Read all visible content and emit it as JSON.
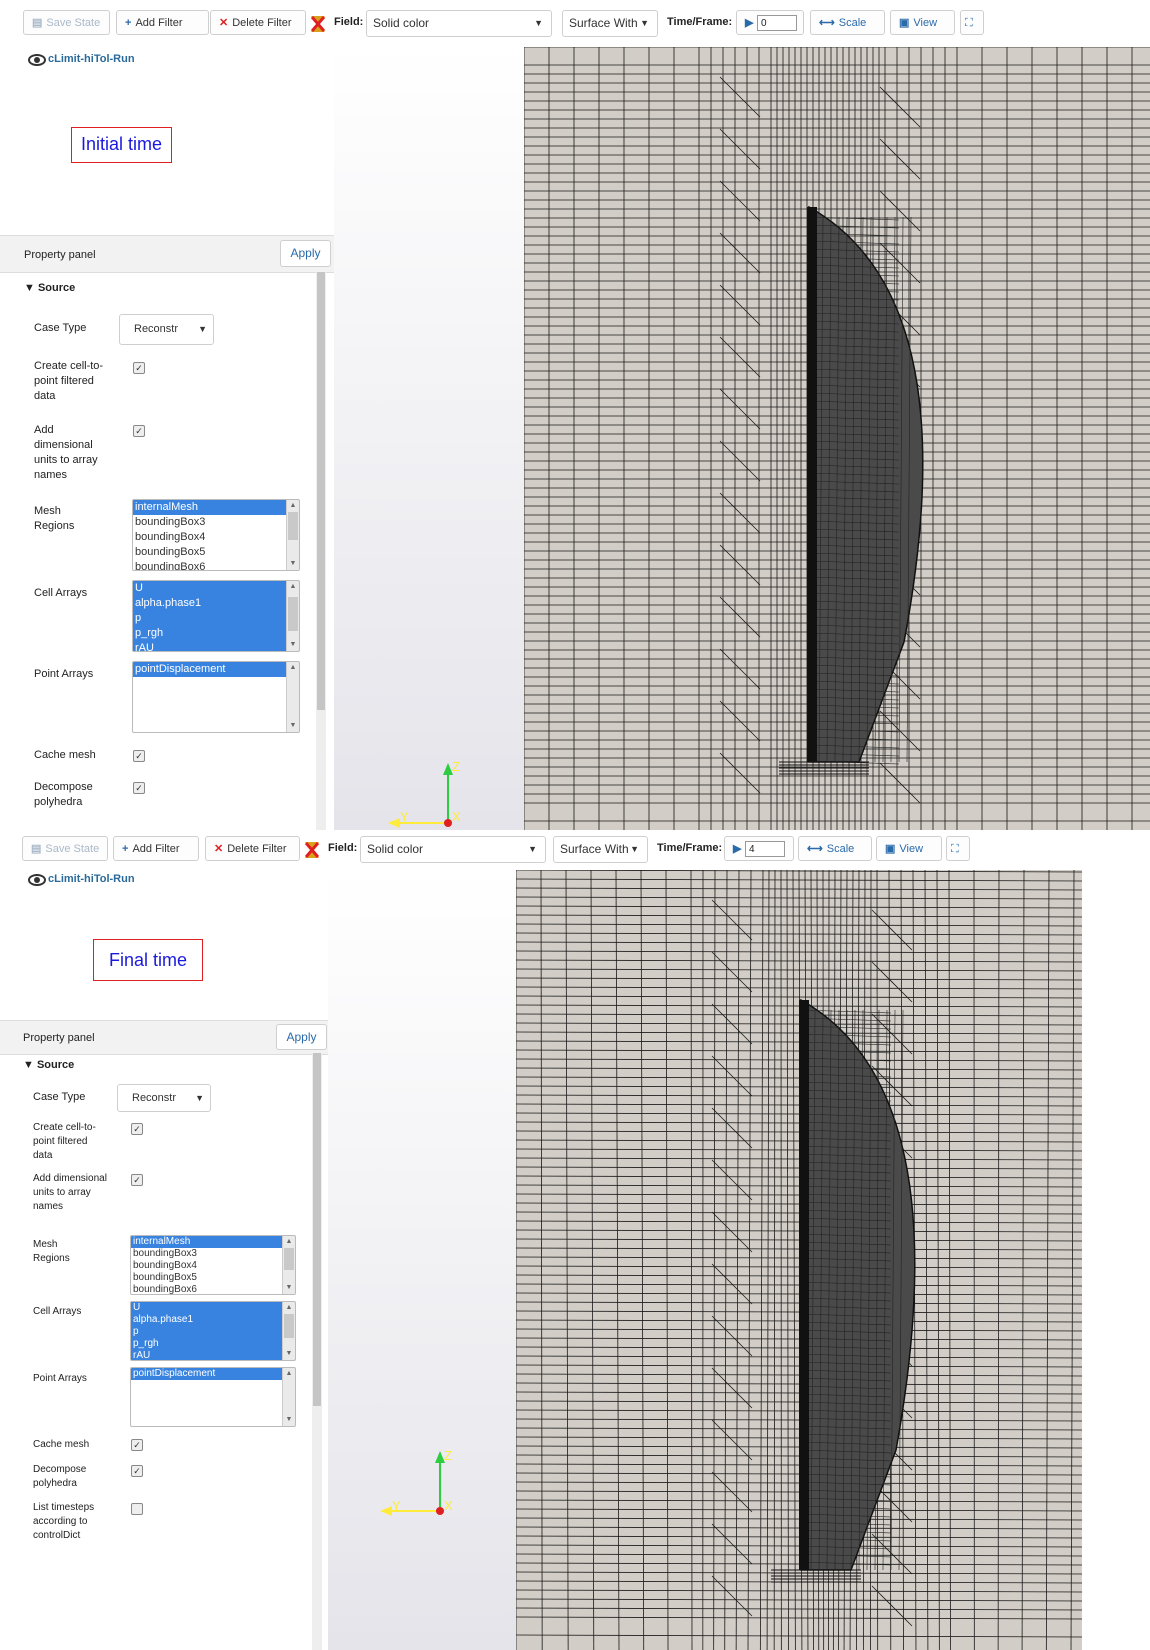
{
  "toolbar": {
    "save_state": "Save State",
    "add_filter": "Add Filter",
    "delete_filter": "Delete Filter",
    "field_label": "Field:",
    "field_value": "Solid color",
    "representation": "Surface With",
    "time_label": "Time/Frame:",
    "scale": "Scale",
    "view": "View"
  },
  "pipeline": {
    "source_name": "cLimit-hiTol-Run"
  },
  "property_panel": {
    "title": "Property panel",
    "apply": "Apply",
    "source_section": "Source",
    "case_type_label": "Case Type",
    "case_type_value": "Reconstr",
    "create_cell_to_point_label": "Create cell-to-point filtered data",
    "add_dimensional_units_label": "Add dimensional units to array names",
    "mesh_regions_label": "Mesh Regions",
    "mesh_regions": [
      "internalMesh",
      "boundingBox3",
      "boundingBox4",
      "boundingBox5",
      "boundingBox6"
    ],
    "cell_arrays_label": "Cell Arrays",
    "cell_arrays": [
      "U",
      "alpha.phase1",
      "p",
      "p_rgh",
      "rAU"
    ],
    "point_arrays_label": "Point Arrays",
    "point_arrays": [
      "pointDisplacement"
    ],
    "cache_mesh_label": "Cache mesh",
    "decompose_polyhedra_label": "Decompose polyhedra",
    "list_timesteps_label": "List timesteps according to controlDict"
  },
  "axes": {
    "z": "Z",
    "y": "Y",
    "x": "X"
  },
  "panels": [
    {
      "annotation": "Initial time",
      "time_frame": "0",
      "create_cell_to_point": true,
      "add_dimensional_units": true,
      "cache_mesh": true,
      "decompose_polyhedra": true
    },
    {
      "annotation": "Final time",
      "time_frame": "4",
      "create_cell_to_point": true,
      "add_dimensional_units": true,
      "cache_mesh": true,
      "decompose_polyhedra": true,
      "list_timesteps": false
    }
  ],
  "colors": {
    "mesh_background": "#d2cdc6",
    "mesh_lines": "#1a1a1a",
    "hull_dark": "#4a4a4a",
    "selection": "#3883e0",
    "annotation_border": "#e02020",
    "annotation_text": "#1a1adf"
  },
  "icons": [
    "save-icon",
    "plus-icon",
    "x-icon",
    "delete-filter-icon",
    "play-step-icon",
    "scale-icon",
    "view-icon",
    "reset-camera-icon",
    "eye-icon"
  ]
}
